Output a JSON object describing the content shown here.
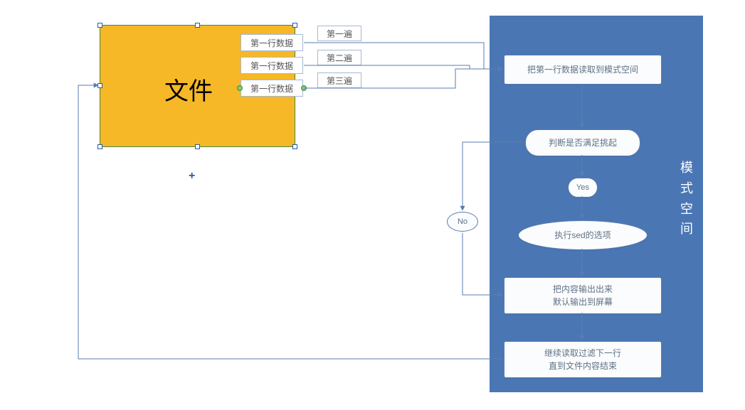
{
  "file_box": {
    "label": "文件",
    "selected": true
  },
  "rows": [
    {
      "label": "第一行数据"
    },
    {
      "label": "第一行数据"
    },
    {
      "label": "第一行数据"
    }
  ],
  "passes": [
    {
      "label": "第一遍"
    },
    {
      "label": "第二遍"
    },
    {
      "label": "第三遍"
    }
  ],
  "panel": {
    "title": "模式空间",
    "nodes": {
      "read": "把第一行数据读取到模式空间",
      "test": "判断是否满足挑起",
      "yes": "Yes",
      "exec": "执行sed的选项",
      "out": "把内容输出出来\n默认输出到屏幕",
      "next": "继续读取过滤下一行\n直到文件内容结束"
    }
  },
  "decision": {
    "no": "No"
  }
}
